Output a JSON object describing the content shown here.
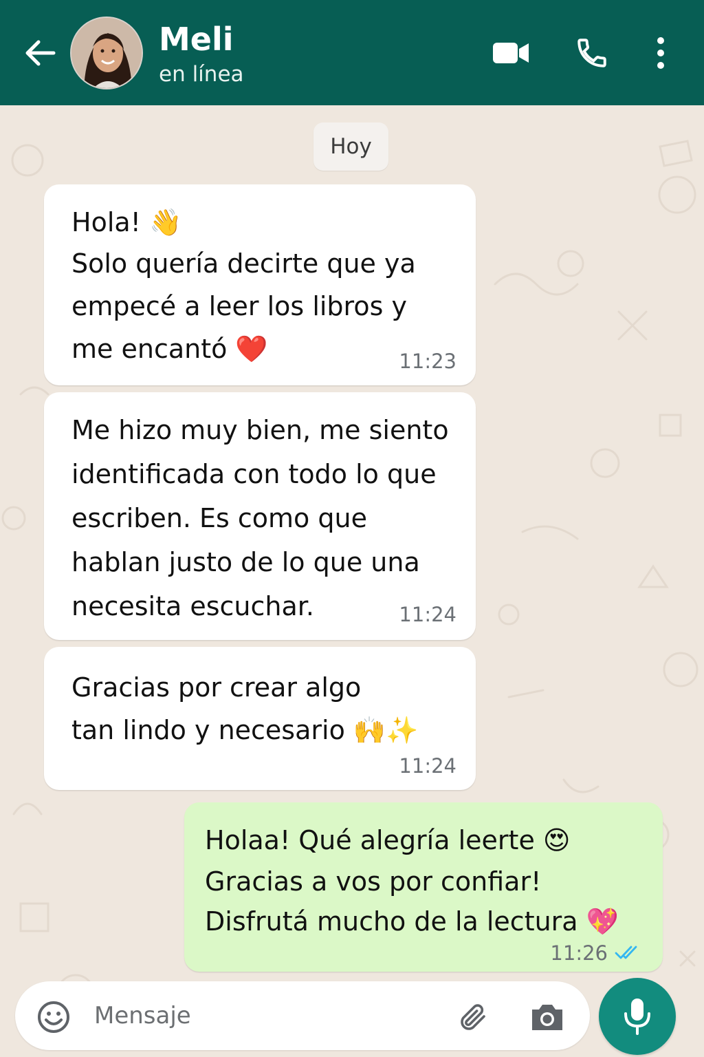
{
  "header": {
    "contact_name": "Meli",
    "status": "en línea",
    "icons": [
      "back-arrow-icon",
      "video-call-icon",
      "phone-icon",
      "more-options-icon"
    ],
    "background_color": "#075e54"
  },
  "chat": {
    "date_label": "Hoy",
    "messages": [
      {
        "direction": "incoming",
        "lines": [
          "Hola! 👋",
          "Solo quería decirte que ya",
          "empecé a leer los libros y",
          "me encantó ❤️"
        ],
        "time": "11:23"
      },
      {
        "direction": "incoming",
        "lines": [
          "Me hizo muy bien, me siento",
          "identificada con todo lo que",
          "escriben. Es como que",
          "hablan justo de lo que una",
          "necesita escuchar."
        ],
        "time": "11:24"
      },
      {
        "direction": "incoming",
        "lines": [
          "Gracias por crear algo",
          "tan lindo y necesario 🙌✨"
        ],
        "time": "11:24"
      },
      {
        "direction": "outgoing",
        "lines": [
          "Holaa! Qué alegría leerte 😍",
          "Gracias a vos por confiar!",
          "Disfrutá mucho de la lectura 💖"
        ],
        "time": "11:26",
        "read_status": "read"
      }
    ],
    "incoming_bubble_color": "#ffffff",
    "outgoing_bubble_color": "#dbf8c7",
    "read_tick_color": "#34b7f1"
  },
  "composer": {
    "placeholder": "Mensaje",
    "icons": [
      "emoji-icon",
      "attach-icon",
      "camera-icon",
      "mic-icon"
    ],
    "mic_button_color": "#128c7e"
  }
}
